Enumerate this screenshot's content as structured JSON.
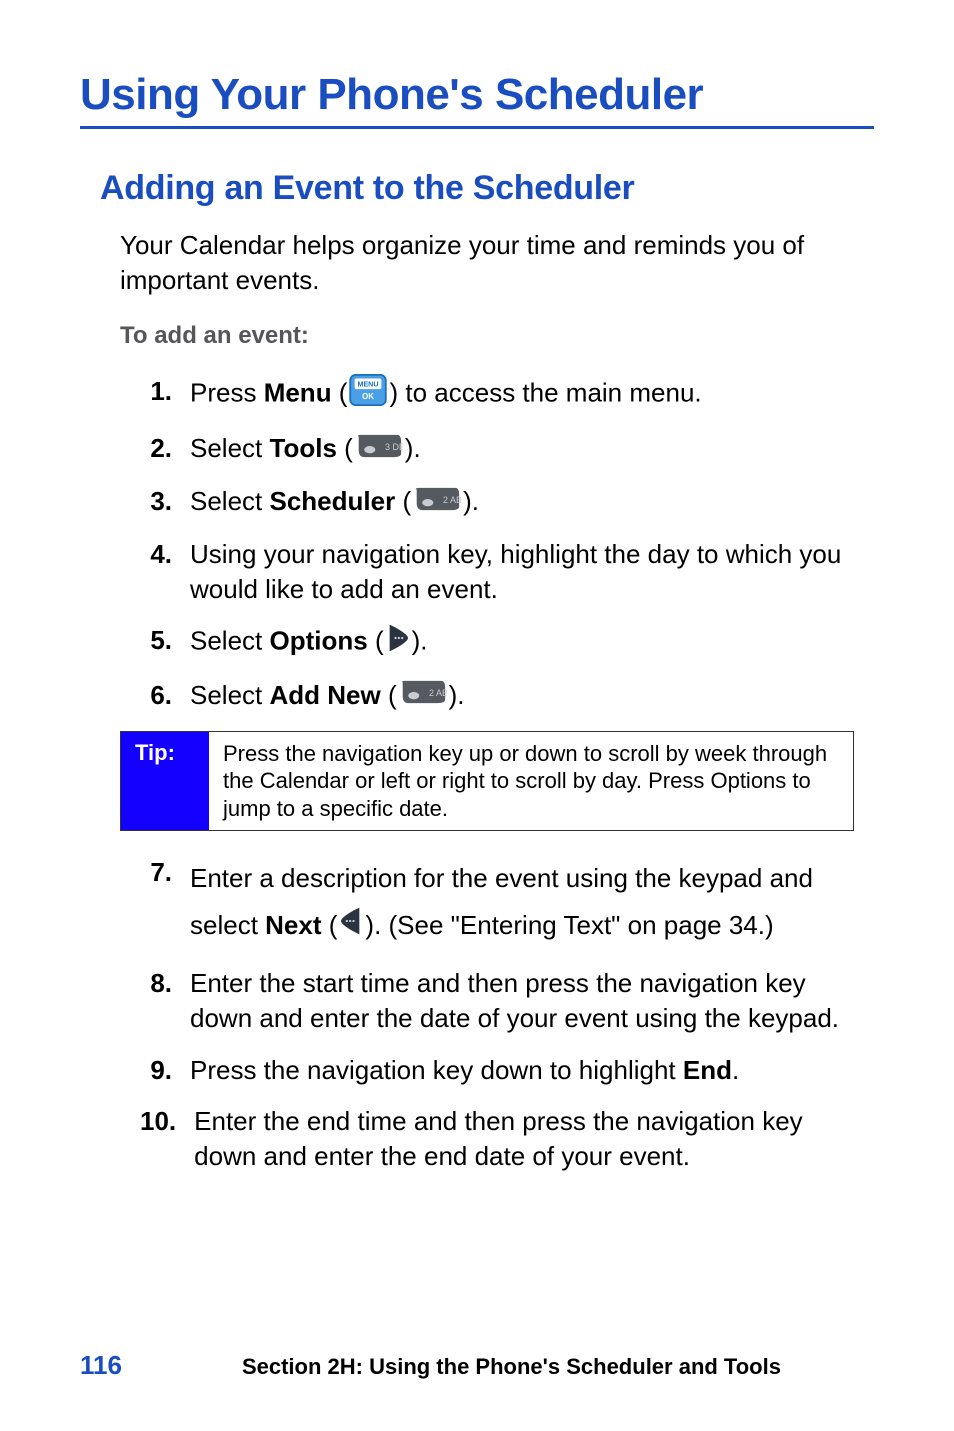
{
  "title": "Using Your Phone's Scheduler",
  "subtitle": "Adding an Event to the Scheduler",
  "intro": "Your Calendar helps organize your time and reminds you of important events.",
  "lead": "To add an event:",
  "steps": {
    "s1": {
      "num": "1.",
      "pre": "Press ",
      "bold": "Menu",
      "post": " to access the main menu.",
      "icon": "menu-ok-key-icon"
    },
    "s2": {
      "num": "2.",
      "pre": "Select ",
      "bold": "Tools",
      "post": ".",
      "icon": "key-3-icon"
    },
    "s3": {
      "num": "3.",
      "pre": "Select ",
      "bold": "Scheduler",
      "post": ".",
      "icon": "key-2-icon"
    },
    "s4": {
      "num": "4.",
      "text": "Using your navigation key, highlight the day to which you would like to add an event."
    },
    "s5": {
      "num": "5.",
      "pre": "Select ",
      "bold": "Options",
      "post": ".",
      "icon": "softkey-right-icon"
    },
    "s6": {
      "num": "6.",
      "pre": "Select ",
      "bold": "Add New",
      "post": ".",
      "icon": "key-2-icon"
    },
    "s7": {
      "num": "7.",
      "pre": "Enter a description for the event using the keypad and select ",
      "bold": "Next",
      "post": ". (See \"Entering Text\" on page 34.)",
      "icon": "softkey-left-icon"
    },
    "s8": {
      "num": "8.",
      "text": "Enter the start time and then press the navigation key down and enter the date of your event using the keypad."
    },
    "s9": {
      "num": "9.",
      "pre": "Press the navigation key down to highlight ",
      "bold": "End",
      "post": "."
    },
    "s10": {
      "num": "10.",
      "text": "Enter the end time and then press the navigation key down and enter the end date of your event."
    }
  },
  "tip": {
    "label": "Tip:",
    "body": "Press the navigation key up or down to scroll by week through the Calendar or left or right to scroll by day. Press Options to jump to a specific date."
  },
  "footer": {
    "page": "116",
    "section": "Section 2H: Using the Phone's Scheduler and Tools"
  }
}
